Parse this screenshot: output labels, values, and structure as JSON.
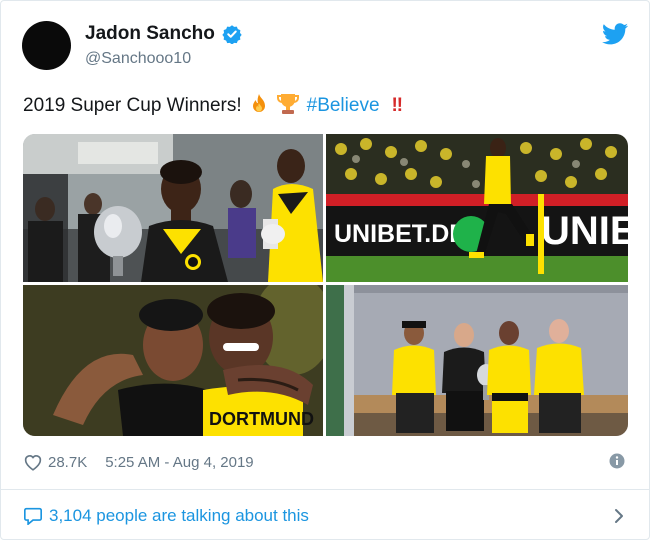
{
  "author": {
    "name": "Jadon Sancho",
    "handle": "@Sanchooo10",
    "verified": true
  },
  "tweet": {
    "text": "2019 Super Cup Winners!",
    "emojis": [
      "fire-emoji",
      "trophy-emoji"
    ],
    "hashtag": "#Believe",
    "exclamation": "‼"
  },
  "media": {
    "count": 4,
    "photos": [
      {
        "overlay_text": ""
      },
      {
        "overlay_text": "UNIBET.DE",
        "overlay_text_2": "UNIE"
      },
      {
        "overlay_text": "DORTMUND"
      },
      {
        "overlay_text": ""
      }
    ]
  },
  "meta": {
    "likes": "28.7K",
    "timestamp": "5:25 AM - Aug 4, 2019"
  },
  "footer": {
    "talking_label": "3,104 people are talking about this"
  },
  "icons": {
    "verified": "verified-badge-icon",
    "brand": "twitter-bird-icon",
    "like": "heart-icon",
    "info": "info-icon",
    "conversation": "speech-bubble-icon",
    "more": "chevron-right-icon"
  },
  "colors": {
    "link": "#1b95e0",
    "secondary_text": "#657786",
    "bvb_yellow": "#fde100"
  }
}
